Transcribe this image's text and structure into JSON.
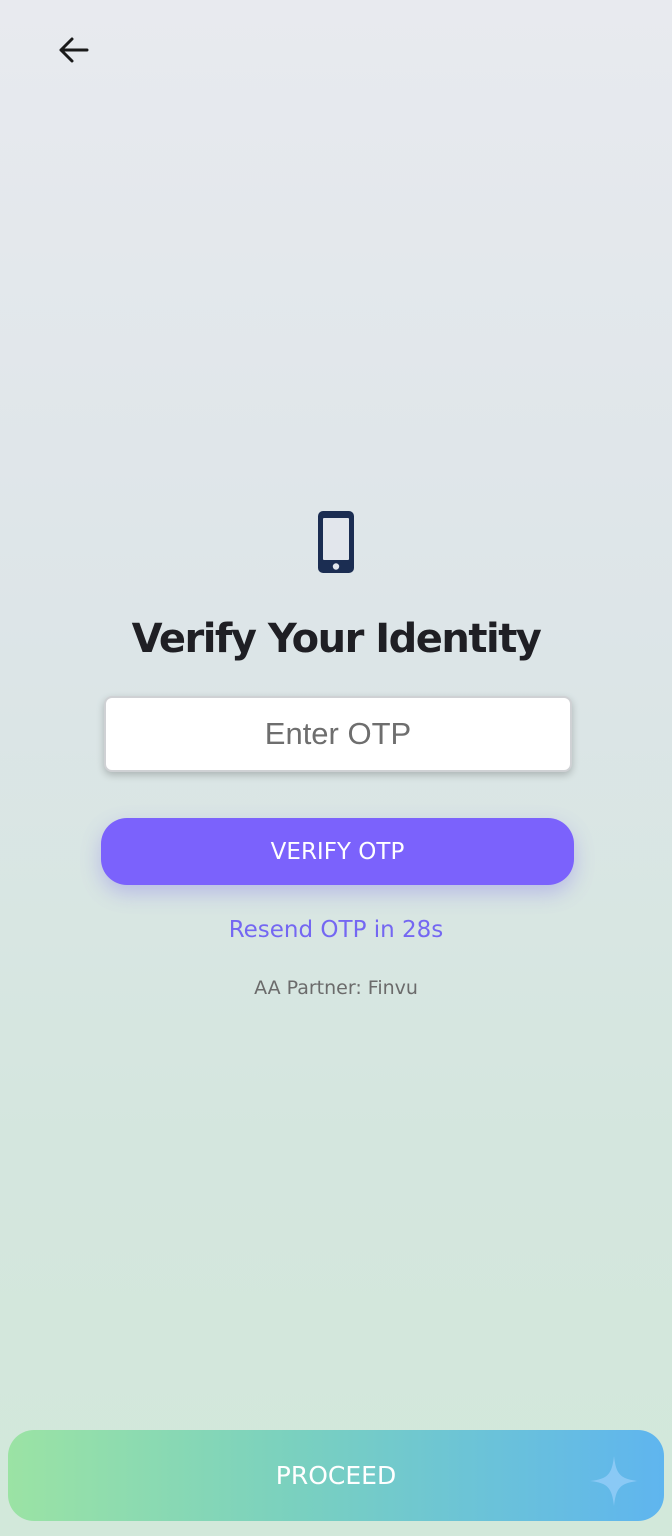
{
  "header": {
    "back_icon": "arrow-left-icon"
  },
  "main": {
    "icon": "smartphone-icon",
    "title": "Verify Your Identity",
    "otp_input": {
      "value": "",
      "placeholder": "Enter OTP"
    },
    "verify_label": "VERIFY OTP",
    "resend_text": "Resend OTP in 28s",
    "partner_text": "AA Partner: Finvu"
  },
  "footer": {
    "proceed_label": "PROCEED",
    "sparkle_icon": "sparkle-icon"
  },
  "colors": {
    "accent": "#7b62fc",
    "resend_link": "#7467f2",
    "icon_navy": "#1b2d52",
    "proceed_gradient_start": "#9be3a4",
    "proceed_gradient_end": "#5fb5ef"
  }
}
